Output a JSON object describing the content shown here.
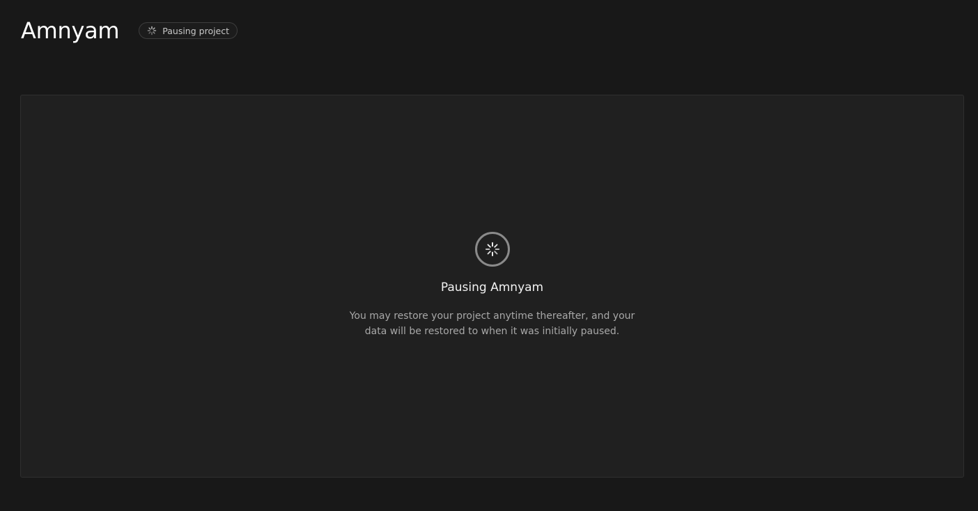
{
  "header": {
    "project_name": "Amnyam",
    "status_badge": {
      "label": "Pausing project",
      "icon": "loading-spinner-icon"
    }
  },
  "panel": {
    "icon": "loading-spinner-icon",
    "title": "Pausing Amnyam",
    "description": "You may restore your project anytime thereafter, and your data will be restored to when it was initially paused."
  },
  "colors": {
    "background": "#181818",
    "panel": "#202020",
    "panel_border": "#2f2f2f",
    "text_primary": "#ffffff",
    "text_secondary": "#a8a8a8"
  }
}
